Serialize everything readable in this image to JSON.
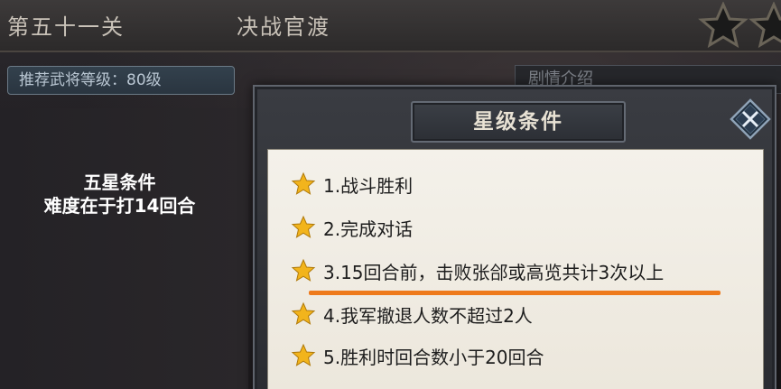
{
  "header": {
    "level_name": "第五十一关",
    "level_title": "决战官渡",
    "stars_visible": 2
  },
  "recommend": {
    "label": "推荐武将等级：80级"
  },
  "story_tab": {
    "label": "剧情介绍"
  },
  "annotation": {
    "line1": "五星条件",
    "line2": "难度在于打14回合"
  },
  "dialog": {
    "title": "星级条件",
    "close_icon": "close-icon",
    "conditions": [
      "1.战斗胜利",
      "2.完成对话",
      "3.15回合前，击败张郃或高览共计3次以上",
      "4.我军撤退人数不超过2人",
      "5.胜利时回合数小于20回合"
    ],
    "highlight_color": "#ee7a1c",
    "star_color": "#f2b41c"
  }
}
